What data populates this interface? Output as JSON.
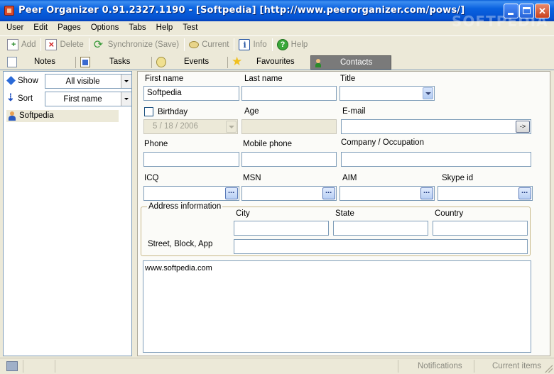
{
  "window": {
    "title": "Peer Organizer 0.91.2327.1190 - [Softpedia] [http://www.peerorganizer.com/pows/]",
    "watermark": "SOFTPEDIA"
  },
  "menu": [
    "User",
    "Edit",
    "Pages",
    "Options",
    "Tabs",
    "Help",
    "Test"
  ],
  "toolbar": {
    "add": "Add",
    "delete": "Delete",
    "synchronize": "Synchronize (Save)",
    "current": "Current",
    "info": "Info",
    "help": "Help"
  },
  "tabs": [
    {
      "label": "Notes",
      "icon": "notes-icon"
    },
    {
      "label": "Tasks",
      "icon": "tasks-icon"
    },
    {
      "label": "Events",
      "icon": "events-icon"
    },
    {
      "label": "Favourites",
      "icon": "star-icon"
    },
    {
      "label": "Contacts",
      "icon": "contacts-icon",
      "active": true
    }
  ],
  "sidebar": {
    "show_label": "Show",
    "show_value": "All visible",
    "sort_label": "Sort",
    "sort_value": "First name",
    "contacts": [
      "Softpedia"
    ]
  },
  "form": {
    "first_name_label": "First name",
    "first_name_value": "Softpedia",
    "last_name_label": "Last name",
    "last_name_value": "",
    "title_label": "Title",
    "title_value": "",
    "birthday_label": "Birthday",
    "birthday_value": "5 / 18 / 2006",
    "age_label": "Age",
    "email_label": "E-mail",
    "email_button": "->",
    "phone_label": "Phone",
    "mobile_label": "Mobile phone",
    "company_label": "Company / Occupation",
    "icq_label": "ICQ",
    "msn_label": "MSN",
    "aim_label": "AIM",
    "skype_label": "Skype id",
    "address_group_label": "Address information",
    "city_label": "City",
    "state_label": "State",
    "country_label": "Country",
    "street_label": "Street, Block, App",
    "notes_value": "www.softpedia.com"
  },
  "status": {
    "notifications": "Notifications",
    "current_items": "Current items"
  }
}
